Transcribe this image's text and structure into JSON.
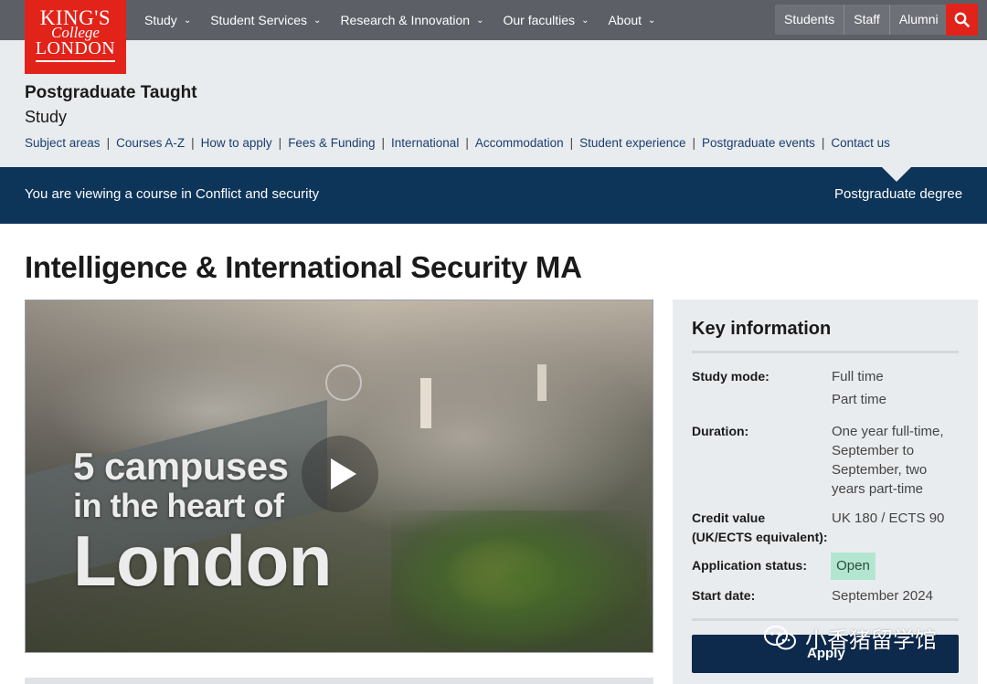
{
  "logo": {
    "line1": "KING'S",
    "line2": "College",
    "line3": "LONDON"
  },
  "nav": {
    "items": [
      "Study",
      "Student Services",
      "Research & Innovation",
      "Our faculties",
      "About"
    ],
    "audience": [
      "Students",
      "Staff",
      "Alumni"
    ]
  },
  "section": {
    "title": "Postgraduate Taught",
    "subtitle": "Study",
    "subnav": [
      "Subject areas",
      "Courses A-Z",
      "How to apply",
      "Fees & Funding",
      "International",
      "Accommodation",
      "Student experience",
      "Postgraduate events",
      "Contact us"
    ]
  },
  "context_bar": {
    "left": "You are viewing a course in Conflict and security",
    "right": "Postgraduate degree"
  },
  "course": {
    "title": "Intelligence & International Security MA"
  },
  "video": {
    "line1": "5 campuses",
    "line2": "in the heart of",
    "line3": "London"
  },
  "key_info": {
    "title": "Key information",
    "study_mode_label": "Study mode:",
    "study_mode_1": "Full time",
    "study_mode_2": "Part time",
    "duration_label": "Duration:",
    "duration_1": "One year full-time,",
    "duration_2": "September to",
    "duration_3": "September, two",
    "duration_4": "years part-time",
    "credit_label_1": "Credit value",
    "credit_label_2": "(UK/ECTS equivalent):",
    "credit_value": "UK 180 / ECTS 90",
    "status_label": "Application status:",
    "status_value": "Open",
    "start_label": "Start date:",
    "start_value": "September 2024",
    "apply_label": "Apply"
  },
  "watermark": {
    "text": "小香猪留学馆"
  },
  "colors": {
    "brand_red": "#e2231a",
    "navy": "#0d3459",
    "status_green": "#b3e6d0"
  }
}
